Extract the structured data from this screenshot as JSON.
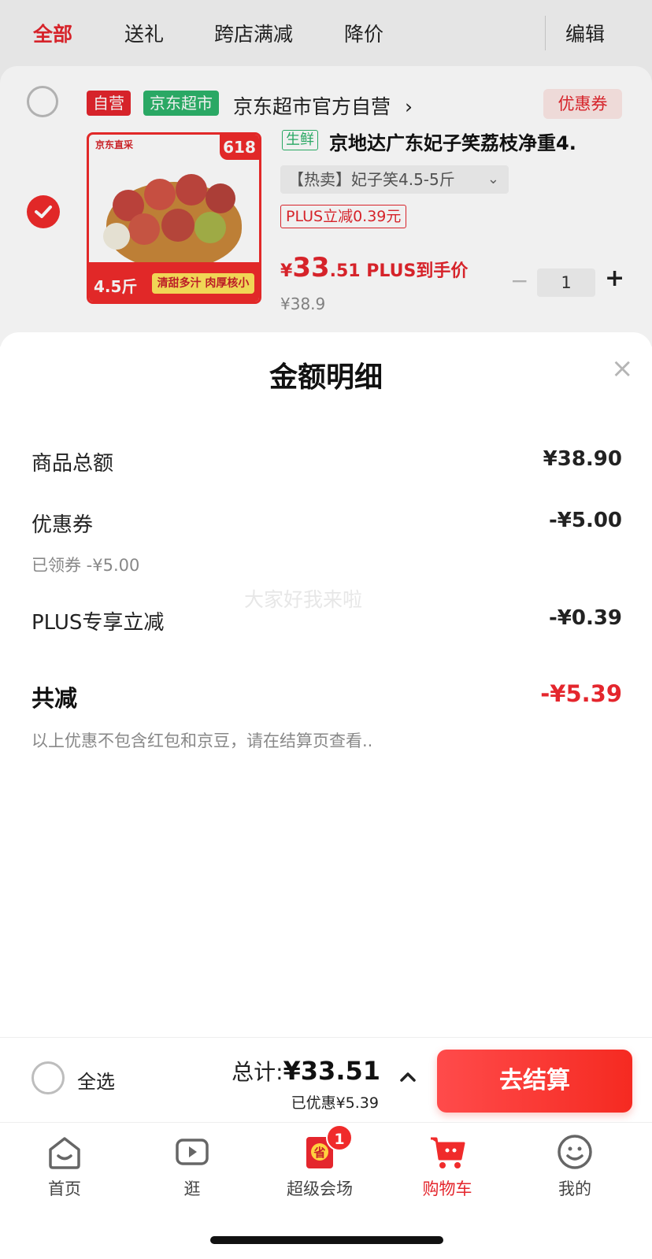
{
  "tabs": {
    "all": "全部",
    "gift": "送礼",
    "cross_store": "跨店满减",
    "price_drop": "降价",
    "edit": "编辑"
  },
  "shop": {
    "tag_self": "自营",
    "tag_market": "京东超市",
    "name": "京东超市官方自营",
    "arrow": "›",
    "coupon": "优惠券"
  },
  "product": {
    "image_brand": "京东直采",
    "image_618": "618",
    "image_weight": "4.5斤",
    "image_slogan": "清甜多汁 肉厚核小",
    "fresh_tag": "生鲜",
    "title": "京地达广东妃子笑荔枝净重4.",
    "variant": "【热卖】妃子笑4.5-5斤",
    "plus_discount": "PLUS立减0.39元",
    "price_yen": "¥",
    "price_int": "33",
    "price_rest": ".51 PLUS到手价",
    "original_price": "¥38.9",
    "quantity": "1",
    "minus": "−",
    "plus": "+"
  },
  "sheet": {
    "title": "金额明细",
    "close": "×",
    "goods_total_label": "商品总额",
    "goods_total_value": "¥38.90",
    "coupon_label": "优惠券",
    "coupon_value": "-¥5.00",
    "coupon_sub": "已领券 -¥5.00",
    "plus_label": "PLUS专享立减",
    "plus_value": "-¥0.39",
    "total_reduce_label": "共减",
    "total_reduce_value": "-¥5.39",
    "note": "以上优惠不包含红包和京豆，请在结算页查看..",
    "watermark": "大家好我来啦"
  },
  "checkout": {
    "select_all": "全选",
    "total_label": "总计:",
    "total_amount": "¥33.51",
    "discounted": "已优惠¥5.39",
    "button": "去结算"
  },
  "nav": {
    "home": "首页",
    "browse": "逛",
    "super_venue": "超级会场",
    "super_venue_badge": "1",
    "super_venue_icon_char": "省",
    "cart": "购物车",
    "mine": "我的"
  },
  "colors": {
    "accent": "#e4262d",
    "market_green": "#2db36b",
    "checkout_gradient_start": "#ff4b4b",
    "checkout_gradient_end": "#f52a21"
  }
}
